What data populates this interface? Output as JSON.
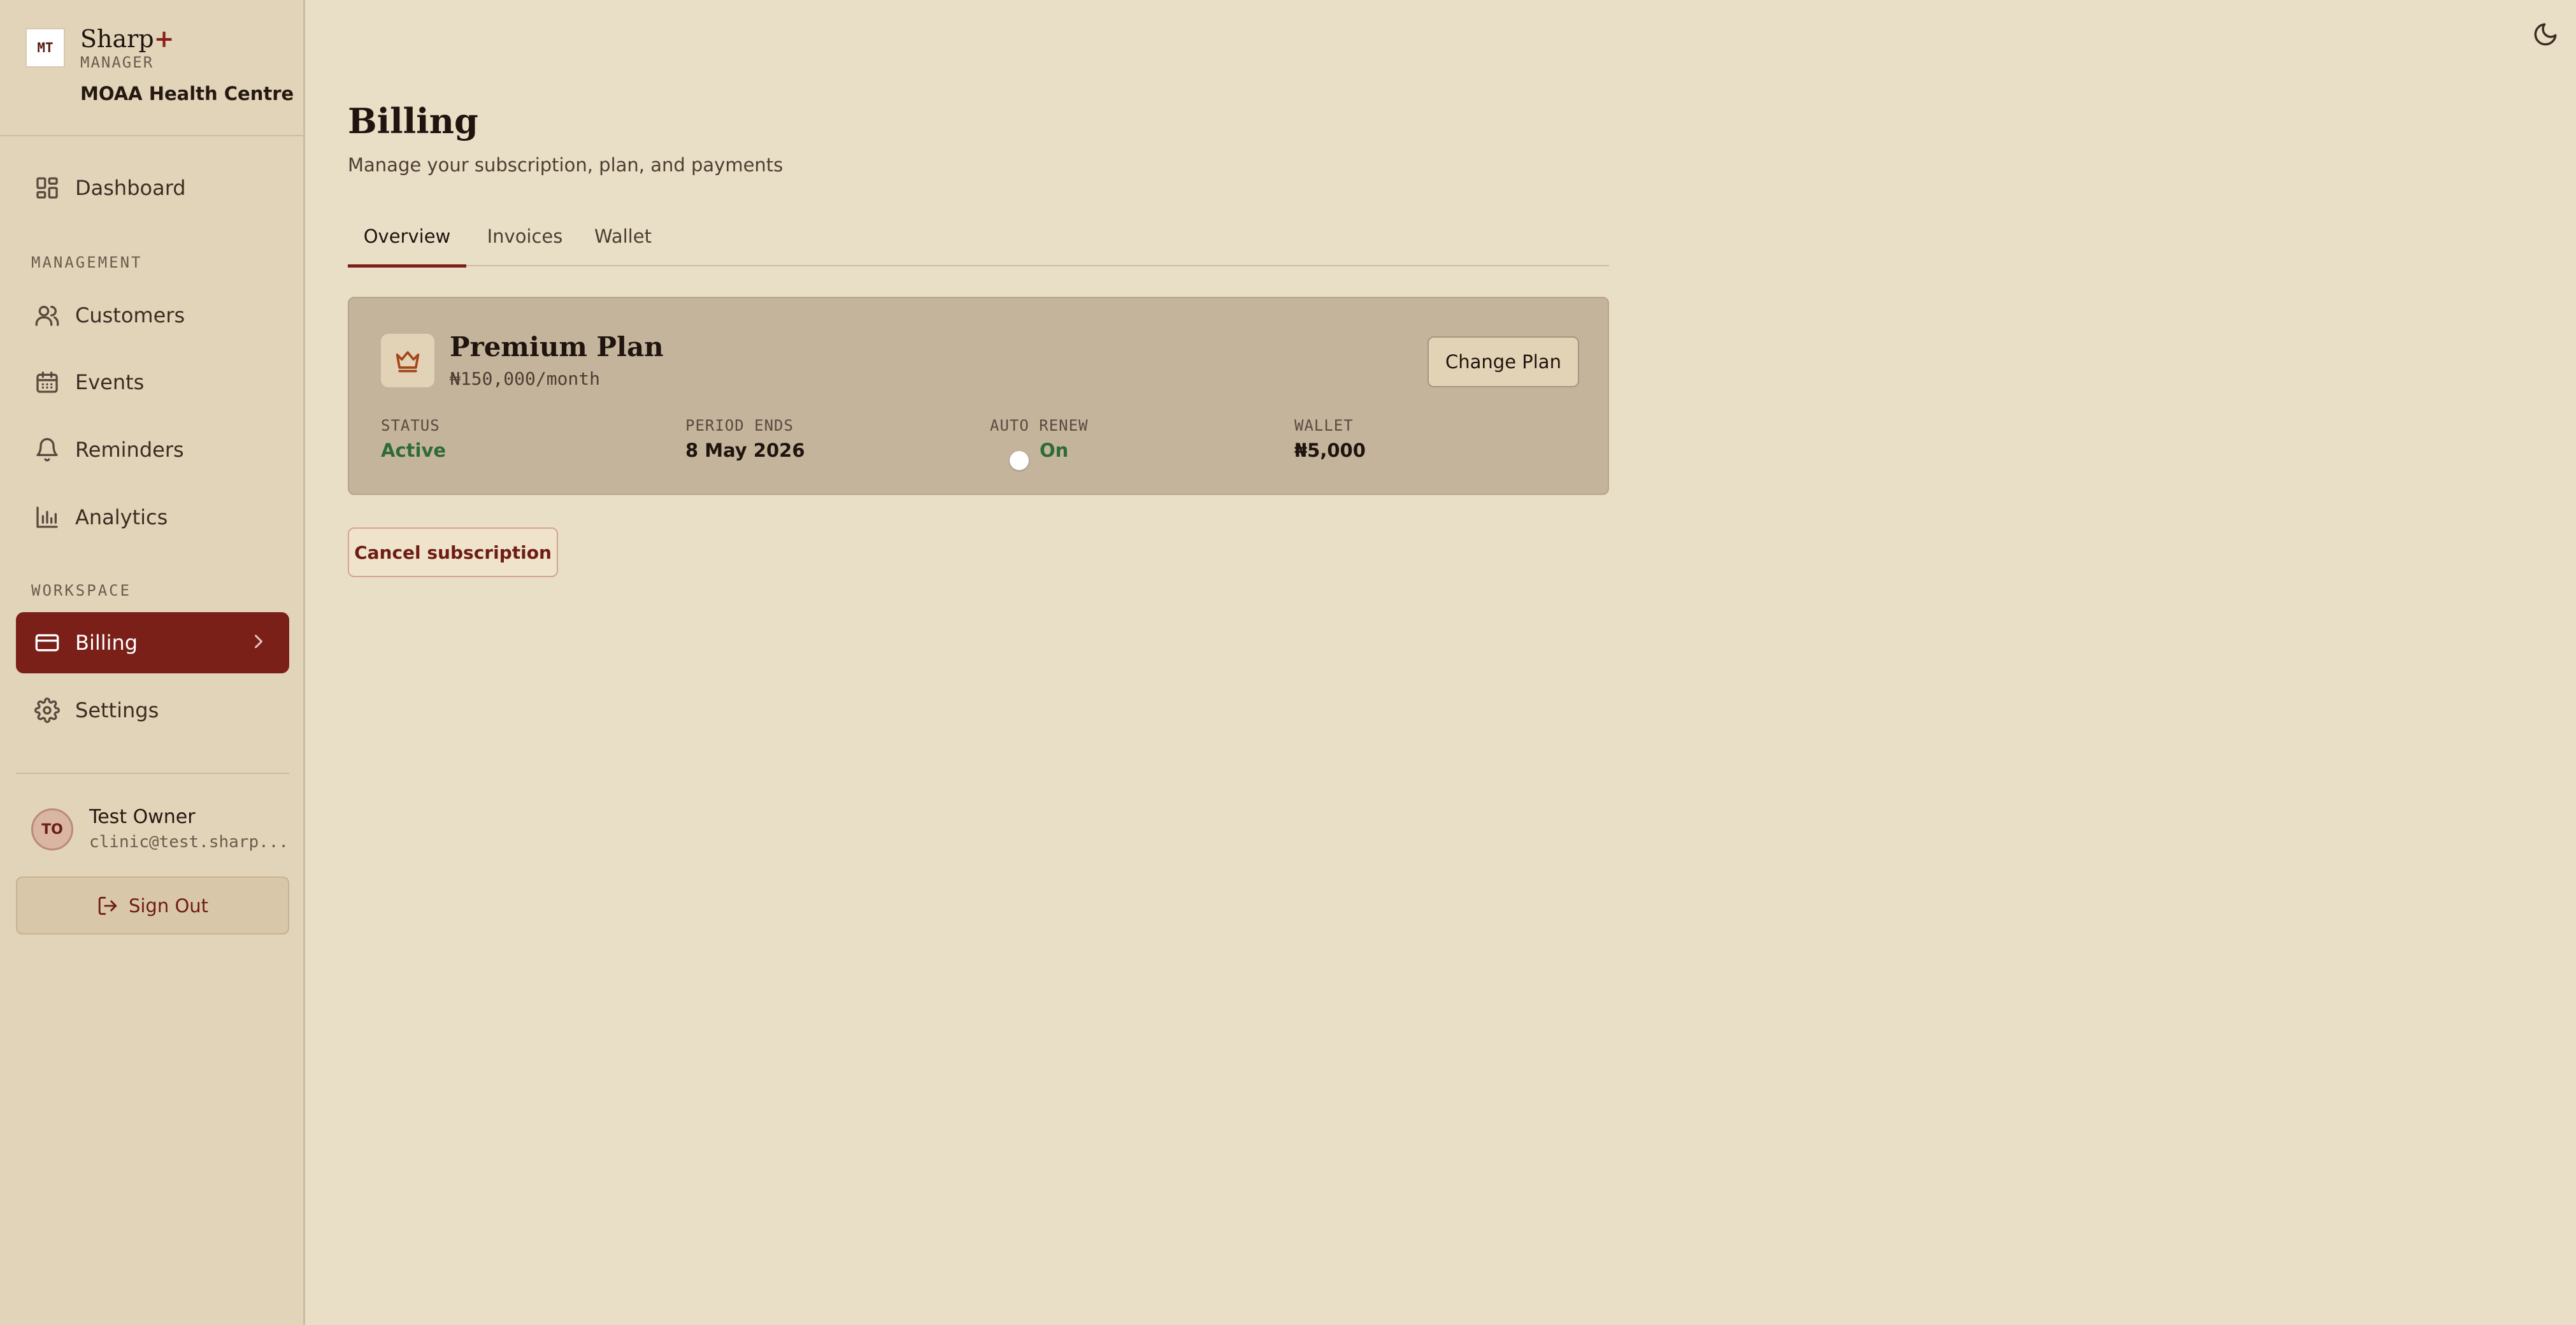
{
  "brand": {
    "logo_text": "MT",
    "name": "Sharp",
    "plus": "+",
    "tag": "MANAGER",
    "org": "MOAA Health Centre"
  },
  "sidebar": {
    "dashboard": "Dashboard",
    "section_management": "MANAGEMENT",
    "customers": "Customers",
    "events": "Events",
    "reminders": "Reminders",
    "analytics": "Analytics",
    "section_workspace": "WORKSPACE",
    "billing": "Billing",
    "settings": "Settings",
    "active_item": "Billing"
  },
  "user": {
    "initials": "TO",
    "name": "Test Owner",
    "email": "clinic@test.sharp..."
  },
  "signout_label": "Sign Out",
  "page": {
    "title": "Billing",
    "subtitle": "Manage your subscription, plan, and payments"
  },
  "tabs": {
    "overview": "Overview",
    "invoices": "Invoices",
    "wallet": "Wallet",
    "active": "Overview"
  },
  "plan": {
    "name": "Premium Plan",
    "price": "₦150,000/month",
    "change_label": "Change Plan",
    "status_label": "STATUS",
    "status_value": "Active",
    "period_label": "PERIOD ENDS",
    "period_value": "8 May 2026",
    "renew_label": "AUTO RENEW",
    "renew_value": "On",
    "wallet_label": "WALLET",
    "wallet_value": "₦5,000"
  },
  "cancel_label": "Cancel subscription",
  "colors": {
    "accent": "#7a2019",
    "background": "#e9dec6",
    "sidebar": "#e2d4b9",
    "card": "#c4b49c",
    "success": "#2f6a3a"
  }
}
